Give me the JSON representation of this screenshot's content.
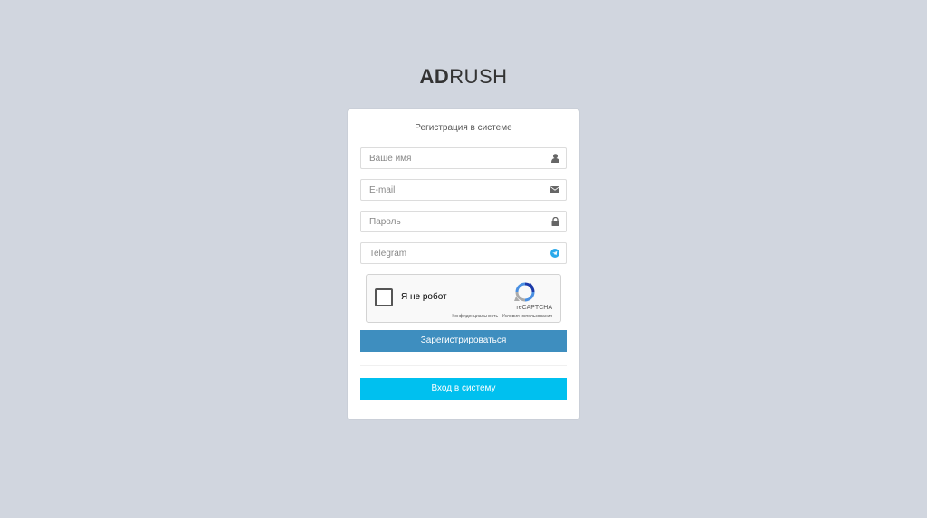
{
  "logo": {
    "bold": "AD",
    "light": "RUSH"
  },
  "form": {
    "title": "Регистрация в системе",
    "fields": [
      {
        "placeholder": "Ваше имя",
        "icon": "user-icon"
      },
      {
        "placeholder": "E-mail",
        "icon": "envelope-icon"
      },
      {
        "placeholder": "Пароль",
        "icon": "lock-icon"
      },
      {
        "placeholder": "Telegram",
        "icon": "telegram-icon"
      }
    ],
    "captcha": {
      "label": "Я не робот",
      "brand": "reCAPTCHA",
      "privacy": "Конфиденциальность",
      "separator": " - ",
      "terms": "Условия использования"
    },
    "register_button": "Зарегистрироваться",
    "login_button": "Вход в систему"
  },
  "colors": {
    "background": "#d1d6df",
    "register_button": "#3e8ebf",
    "login_button": "#00c0ef",
    "telegram_icon": "#29a9eb"
  }
}
